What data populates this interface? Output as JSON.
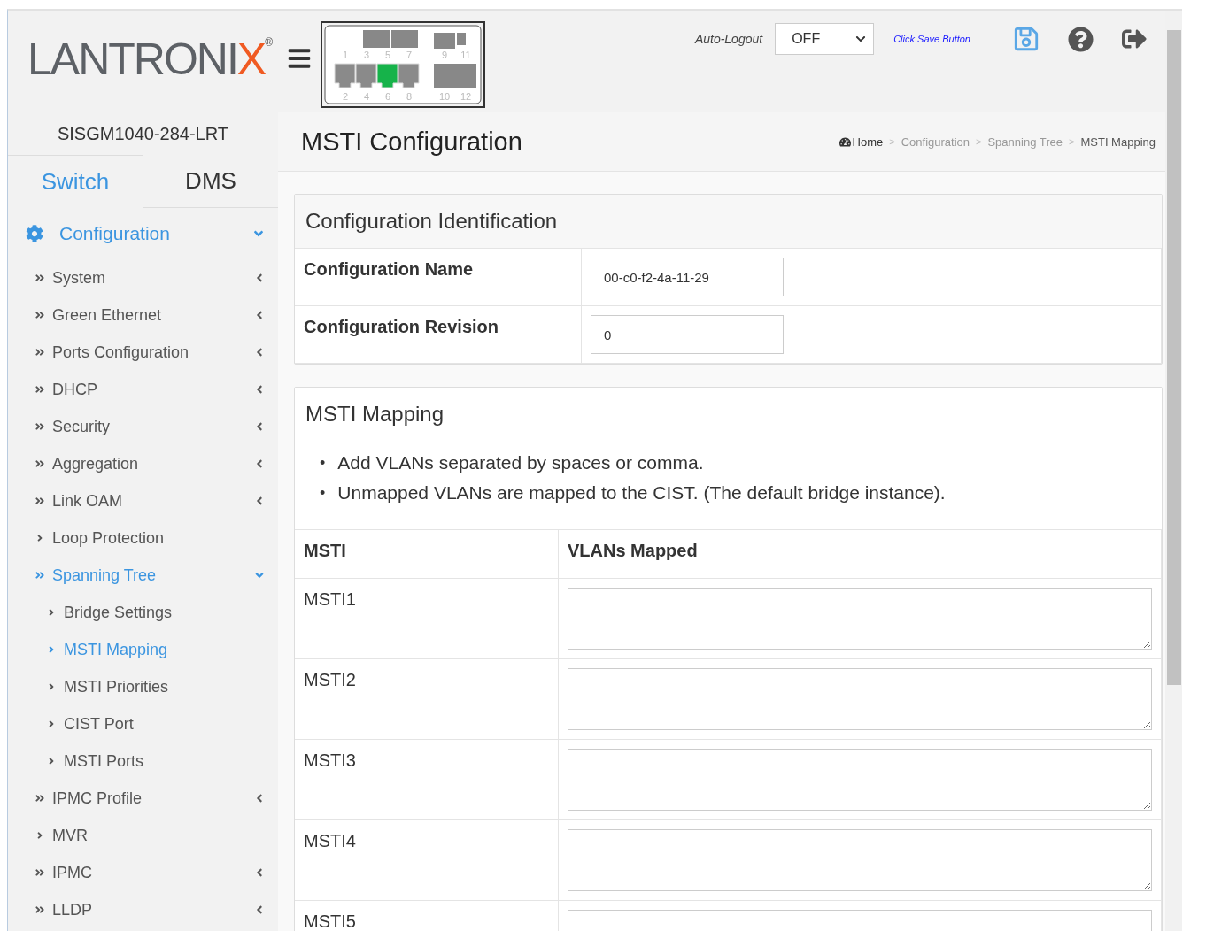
{
  "logo": {
    "text": "LANTRONI",
    "accent": "X",
    "mark": "®"
  },
  "port_panel": {
    "top_labels": [
      "1",
      "3",
      "5",
      "7",
      "9",
      "11"
    ],
    "bottom_labels": [
      "2",
      "4",
      "6",
      "8",
      "10",
      "12"
    ],
    "ports": [
      {
        "link": false
      },
      {
        "link": false
      },
      {
        "link": true
      },
      {
        "link": false
      }
    ]
  },
  "header": {
    "auto_logout_label": "Auto-Logout",
    "auto_logout_value": "OFF",
    "save_hint": "Click Save Button"
  },
  "device_name": "SISGM1040-284-LRT",
  "tabs": [
    {
      "label": "Switch",
      "selected": true
    },
    {
      "label": "DMS",
      "selected": false
    }
  ],
  "menu_section": {
    "label": "Configuration",
    "expanded": true
  },
  "menu": [
    {
      "label": "System",
      "kind": "group",
      "selected": false,
      "expanded": false
    },
    {
      "label": "Green Ethernet",
      "kind": "group",
      "selected": false,
      "expanded": false
    },
    {
      "label": "Ports Configuration",
      "kind": "group",
      "selected": false,
      "expanded": false
    },
    {
      "label": "DHCP",
      "kind": "group",
      "selected": false,
      "expanded": false
    },
    {
      "label": "Security",
      "kind": "group",
      "selected": false,
      "expanded": false
    },
    {
      "label": "Aggregation",
      "kind": "group",
      "selected": false,
      "expanded": false
    },
    {
      "label": "Link OAM",
      "kind": "group",
      "selected": false,
      "expanded": false
    },
    {
      "label": "Loop Protection",
      "kind": "link",
      "selected": false
    },
    {
      "label": "Spanning Tree",
      "kind": "group",
      "selected": true,
      "expanded": true,
      "children": [
        {
          "label": "Bridge Settings",
          "kind": "link",
          "selected": false
        },
        {
          "label": "MSTI Mapping",
          "kind": "link",
          "selected": true
        },
        {
          "label": "MSTI Priorities",
          "kind": "link",
          "selected": false
        },
        {
          "label": "CIST Port",
          "kind": "link",
          "selected": false
        },
        {
          "label": "MSTI Ports",
          "kind": "link",
          "selected": false
        }
      ]
    },
    {
      "label": "IPMC Profile",
      "kind": "group",
      "selected": false,
      "expanded": false
    },
    {
      "label": "MVR",
      "kind": "link",
      "selected": false
    },
    {
      "label": "IPMC",
      "kind": "group",
      "selected": false,
      "expanded": false
    },
    {
      "label": "LLDP",
      "kind": "group",
      "selected": false,
      "expanded": false
    }
  ],
  "page_title": "MSTI Configuration",
  "breadcrumb": [
    "Home",
    "Configuration",
    "Spanning Tree",
    "MSTI Mapping"
  ],
  "breadcrumb_separators": [
    ">",
    ">",
    ">"
  ],
  "identification": {
    "title": "Configuration Identification",
    "rows": [
      {
        "label": "Configuration Name",
        "value": "00-c0-f2-4a-11-29"
      },
      {
        "label": "Configuration Revision",
        "value": "0"
      }
    ]
  },
  "mapping": {
    "title": "MSTI Mapping",
    "notes": [
      {
        "bullet": "•",
        "text": "Add VLANs separated by spaces or comma."
      },
      {
        "bullet": "•",
        "text": "Unmapped VLANs are mapped to the CIST. (The default bridge instance)."
      }
    ],
    "columns": [
      "MSTI",
      "VLANs Mapped"
    ],
    "rows": [
      {
        "msti": "MSTI1"
      },
      {
        "msti": "MSTI2"
      },
      {
        "msti": "MSTI3"
      },
      {
        "msti": "MSTI4"
      },
      {
        "msti": "MSTI5"
      }
    ]
  }
}
